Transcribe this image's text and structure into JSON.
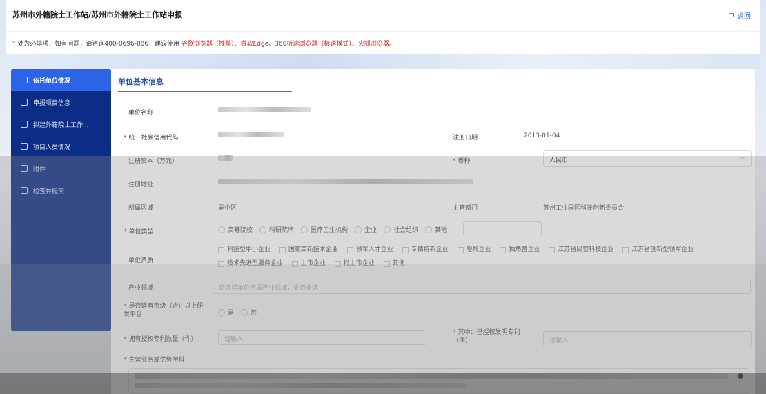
{
  "header": {
    "title": "苏州市外籍院士工作站/苏州市外籍院士工作站申报",
    "back_label": "返回"
  },
  "notice": {
    "required_mark": "*",
    "text_prefix": "处为必填项，如有问题，请咨询400-8696-086，建议使用",
    "browser_list": "谷歌浏览器（推荐）、微软Edge、360极速浏览器（极速模式）、火狐浏览器。"
  },
  "sidebar": {
    "items": [
      {
        "label": "依托单位情况",
        "icon": "building-icon",
        "active": true
      },
      {
        "label": "申报项目信息",
        "icon": "document-icon",
        "active": false
      },
      {
        "label": "拟建外籍院士工作...",
        "icon": "people-icon",
        "active": false
      },
      {
        "label": "项目人员情况",
        "icon": "id-card-icon",
        "active": false
      },
      {
        "label": "附件",
        "icon": "paperclip-icon",
        "active": false
      },
      {
        "label": "检查并提交",
        "icon": "checklist-icon",
        "active": false
      }
    ]
  },
  "form": {
    "section_title": "单位基本信息",
    "fields": {
      "unit_name": {
        "label": "单位名称"
      },
      "credit_code": {
        "label": "统一社会信用代码",
        "required": true
      },
      "reg_date": {
        "label": "注册日期",
        "value": "2013-01-04"
      },
      "reg_capital": {
        "label": "注册资本（万元）"
      },
      "currency": {
        "label": "币种",
        "required": true,
        "value": "人民币"
      },
      "reg_address": {
        "label": "注册地址"
      },
      "region": {
        "label": "所属区域",
        "value": "吴中区"
      },
      "dept": {
        "label": "主管部门",
        "value": "苏州工业园区科技创新委员会"
      },
      "unit_type": {
        "label": "单位类型",
        "required": true,
        "options": [
          "高等院校",
          "科研院所",
          "医疗卫生机构",
          "企业",
          "社会组织",
          "其他"
        ]
      },
      "qualification": {
        "label": "单位资质",
        "options": [
          "科技型中小企业",
          "国家高新技术企业",
          "领军人才企业",
          "专精特新企业",
          "瞪羚企业",
          "独角兽企业",
          "江苏省民营科技企业",
          "江苏省创新型领军企业",
          "技术先进型服务企业",
          "上市企业",
          "拟上市企业",
          "其他"
        ]
      },
      "industry": {
        "label": "产业领域",
        "placeholder": "请选择单位所属产业领域，支持多选"
      },
      "rd_platform": {
        "label": "是否建有市级（含）以上研发平台",
        "required": true,
        "options": [
          "是",
          "否"
        ]
      },
      "patent_count": {
        "label": "拥有授权专利数量（件）",
        "required": true,
        "placeholder": "请输入"
      },
      "invention_patent": {
        "label": "其中：已授权发明专利（件）",
        "required": true,
        "placeholder": "请输入"
      },
      "main_business": {
        "label": "主营业务或优势学科",
        "required": true
      }
    }
  }
}
